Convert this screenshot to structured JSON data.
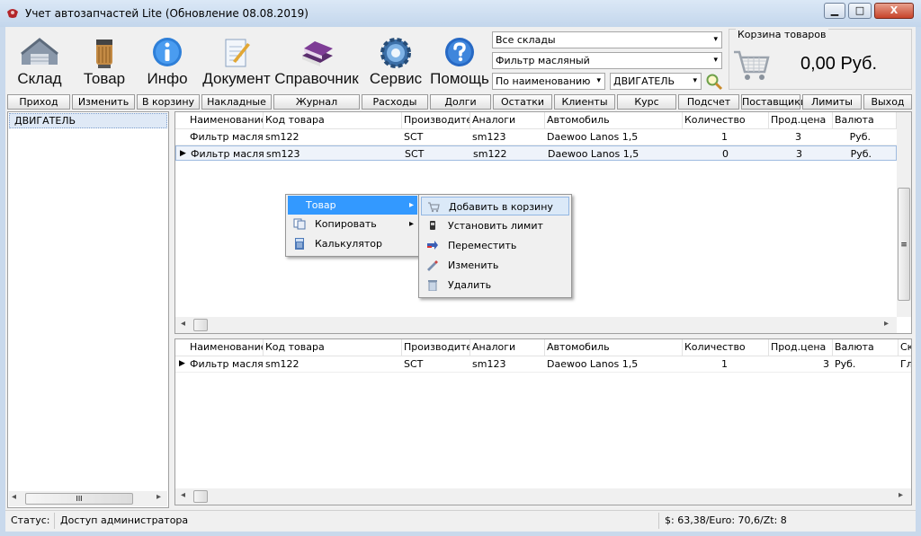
{
  "window": {
    "title": "Учет автозапчастей Lite (Обновление 08.08.2019)",
    "min_glyph": "▁",
    "max_glyph": "□",
    "close_glyph": "X"
  },
  "toolbar": {
    "buttons": [
      {
        "label": "Склад",
        "icon": "warehouse-icon"
      },
      {
        "label": "Товар",
        "icon": "oil-filter-icon"
      },
      {
        "label": "Инфо",
        "icon": "info-icon"
      },
      {
        "label": "Документ",
        "icon": "document-icon"
      },
      {
        "label": "Справочник",
        "icon": "books-icon"
      },
      {
        "label": "Сервис",
        "icon": "gear-icon"
      },
      {
        "label": "Помощь",
        "icon": "help-icon"
      }
    ],
    "warehouse_select": "Все склады",
    "search_value": "Фильтр масляный",
    "search_mode": "По наименованию",
    "category_select": "ДВИГАТЕЛЬ"
  },
  "cart": {
    "title": "Корзина товаров",
    "total": "0,00 Руб."
  },
  "nav_buttons": [
    "Приход",
    "Изменить",
    "В корзину",
    "Накладные",
    "Журнал",
    "Расходы",
    "Долги",
    "Остатки",
    "Клиенты",
    "Курс",
    "Подсчет",
    "Поставщики",
    "Лимиты",
    "Выход"
  ],
  "tree": {
    "items": [
      "ДВИГАТЕЛЬ"
    ],
    "scroll_glyph": "III"
  },
  "top_grid": {
    "columns": [
      "Наименование",
      "Код товара",
      "Производител",
      "Аналоги",
      "Автомобиль",
      "Количество",
      "Прод.цена",
      "Валюта"
    ],
    "rows": [
      {
        "name": "Фильтр масляный",
        "code": "sm122",
        "maker": "SCT",
        "analog": "sm123",
        "car": "Daewoo Lanos 1,5",
        "qty": "1",
        "price": "3",
        "currency": "Руб."
      },
      {
        "name": "Фильтр масляный",
        "code": "sm123",
        "maker": "SCT",
        "analog": "sm122",
        "car": "Daewoo Lanos 1,5",
        "qty": "0",
        "price": "3",
        "currency": "Руб."
      }
    ]
  },
  "bottom_grid": {
    "columns": [
      "Наименование",
      "Код товара",
      "Производител",
      "Аналоги",
      "Автомобиль",
      "Количество",
      "Прод.цена",
      "Валюта",
      "Ск"
    ],
    "rows": [
      {
        "name": "Фильтр масляный",
        "code": "sm122",
        "maker": "SCT",
        "analog": "sm123",
        "car": "Daewoo Lanos 1,5",
        "qty": "1",
        "price": "3",
        "currency": "Руб.",
        "extra": "Гл"
      }
    ]
  },
  "context_menu": {
    "items": [
      "Товар",
      "Копировать",
      "Калькулятор"
    ],
    "submenu": [
      "Добавить в корзину",
      "Установить лимит",
      "Переместить",
      "Изменить",
      "Удалить"
    ]
  },
  "status": {
    "label": "Статус:",
    "text": "Доступ администратора",
    "rates": "$: 63,38/Euro: 70,6/Zt: 8"
  },
  "glyphs": {
    "arrow_right": "▸",
    "arrow_left": "◂",
    "arrow_down": "▾",
    "row_marker": "▶",
    "scroll_grip": "≡"
  },
  "colors": {
    "menu_highlight": "#3399ff",
    "title_bar": "#c3d6ec",
    "selected_row": "#e8f0fb"
  }
}
